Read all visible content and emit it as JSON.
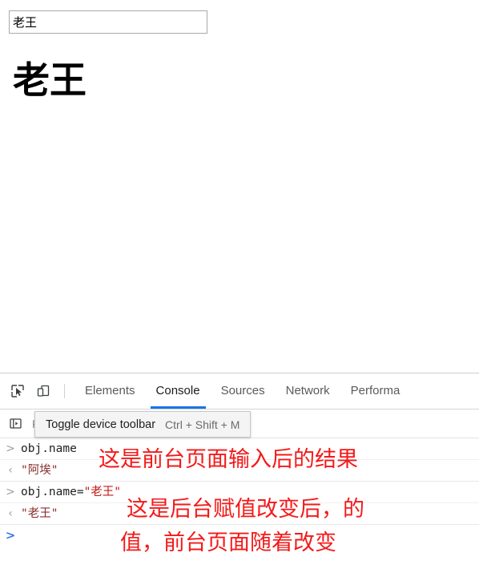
{
  "page": {
    "input_value": "老王",
    "input_placeholder": "",
    "heading": "老王"
  },
  "devtools": {
    "icons": {
      "inspect": "inspect-element-icon",
      "device": "device-toolbar-icon",
      "sidebar": "console-sidebar-icon"
    },
    "tabs": [
      {
        "label": "Elements",
        "active": false
      },
      {
        "label": "Console",
        "active": true
      },
      {
        "label": "Sources",
        "active": false
      },
      {
        "label": "Network",
        "active": false
      },
      {
        "label": "Performa",
        "active": false
      }
    ],
    "toolbar": {
      "filter_placeholder": "Filter",
      "filter_value": ""
    },
    "tooltip": {
      "title": "Toggle device toolbar",
      "shortcut": "Ctrl + Shift + M"
    },
    "console": {
      "prompt_glyph": ">",
      "result_glyph": "‹",
      "messages": [
        {
          "type": "command",
          "text": "obj.name"
        },
        {
          "type": "result",
          "text": "\"阿埃\""
        },
        {
          "type": "command",
          "text": "obj.name=",
          "value": "\"老王\""
        },
        {
          "type": "result",
          "text": "\"老王\""
        },
        {
          "type": "prompt",
          "text": ""
        }
      ]
    },
    "annotations": [
      {
        "text": "这是前台页面输入后的结果"
      },
      {
        "text": "这是后台赋值改变后，的"
      },
      {
        "text": "值，前台页面随着改变"
      }
    ]
  },
  "colors": {
    "accent": "#1a73e8",
    "annotation": "#f41919",
    "string": "#c41a16",
    "prompt_blue": "#3b78e7"
  }
}
